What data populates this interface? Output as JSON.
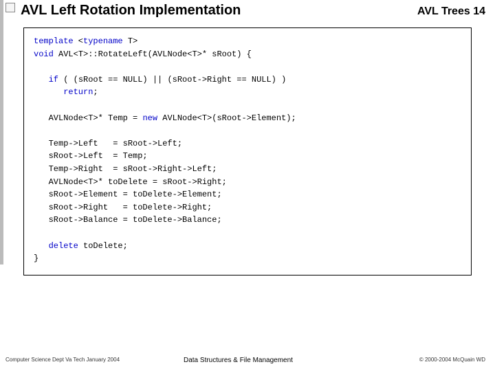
{
  "header": {
    "title": "AVL Left Rotation Implementation",
    "page_label": "AVL Trees  14"
  },
  "code": {
    "kw_template": "template",
    "tparam": " <",
    "kw_typename": "typename",
    "tparam_end": " T>",
    "kw_void": "void",
    "sig": " AVL<T>::RotateLeft(AVLNode<T>* sRoot) {",
    "blank1": "",
    "kw_if": "   if",
    "cond": " ( (sRoot == NULL) || (sRoot->Right == NULL) )",
    "kw_return": "      return",
    "semi1": ";",
    "blank2": "",
    "decl1_a": "   AVLNode<T>* Temp = ",
    "kw_new": "new",
    "decl1_b": " AVLNode<T>(sRoot->Element);",
    "blank3": "",
    "l1": "   Temp->Left   = sRoot->Left;",
    "l2": "   sRoot->Left  = Temp;",
    "l3": "   Temp->Right  = sRoot->Right->Left;",
    "l4": "   AVLNode<T>* toDelete = sRoot->Right;",
    "l5": "   sRoot->Element = toDelete->Element;",
    "l6": "   sRoot->Right   = toDelete->Right;",
    "l7": "   sRoot->Balance = toDelete->Balance;",
    "blank4": "",
    "kw_delete": "   delete",
    "del_rest": " toDelete;",
    "close": "}"
  },
  "footer": {
    "left": "Computer Science Dept Va Tech January 2004",
    "center": "Data Structures & File Management",
    "right": "© 2000-2004  McQuain WD"
  }
}
